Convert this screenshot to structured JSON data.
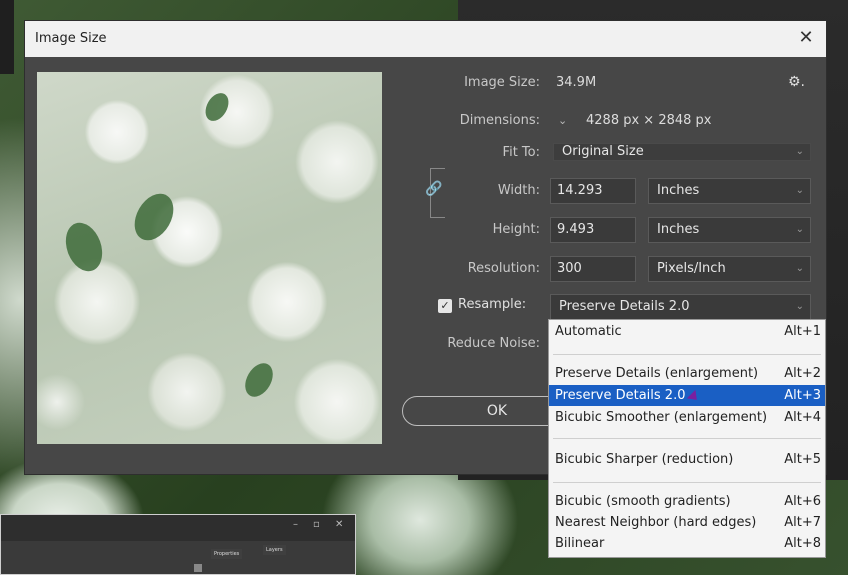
{
  "dialog": {
    "title": "Image Size",
    "close": "✕",
    "image_size_label": "Image Size:",
    "image_size_value": "34.9M",
    "gear": "⚙.",
    "dimensions_label": "Dimensions:",
    "dimensions_value": "4288 px  ×  2848 px",
    "fit_to_label": "Fit To:",
    "fit_to_value": "Original Size",
    "width_label": "Width:",
    "width_value": "14.293",
    "width_unit": "Inches",
    "height_label": "Height:",
    "height_value": "9.493",
    "height_unit": "Inches",
    "resolution_label": "Resolution:",
    "resolution_value": "300",
    "resolution_unit": "Pixels/Inch",
    "resample_label": "Resample:",
    "resample_value": "Preserve Details 2.0",
    "reduce_noise_label": "Reduce Noise:",
    "ok_label": "OK"
  },
  "resample_menu": {
    "items": [
      {
        "label": "Automatic",
        "shortcut": "Alt+1"
      },
      {
        "label": "Preserve Details (enlargement)",
        "shortcut": "Alt+2"
      },
      {
        "label": "Preserve Details 2.0",
        "shortcut": "Alt+3",
        "selected": true
      },
      {
        "label": "Bicubic Smoother (enlargement)",
        "shortcut": "Alt+4"
      },
      {
        "label": "Bicubic Sharper (reduction)",
        "shortcut": "Alt+5"
      },
      {
        "label": "Bicubic (smooth gradients)",
        "shortcut": "Alt+6"
      },
      {
        "label": "Nearest Neighbor (hard edges)",
        "shortcut": "Alt+7"
      },
      {
        "label": "Bilinear",
        "shortcut": "Alt+8"
      }
    ]
  },
  "background_window": {
    "tab_properties": "Properties",
    "tab_layers": "Layers",
    "controls": [
      "–",
      "▫",
      "✕"
    ]
  },
  "colors": {
    "dialog_bg": "#474747",
    "menu_highlight": "#1a5fc4"
  }
}
